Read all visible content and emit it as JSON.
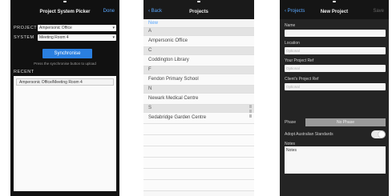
{
  "screen1": {
    "title": "Project System Picker",
    "done_label": "Done",
    "project_label": "PROJECT",
    "project_value": "Ampersonic Office",
    "system_label": "SYSTEM",
    "system_value": "Meeting Room 4",
    "sync_button": "Synchronise",
    "hint": "Press the synchronise button to upload",
    "recent_header": "RECENT",
    "recent_items": [
      "Ampersonic Office/Meeting Room 4"
    ]
  },
  "screen2": {
    "back_label": "Back",
    "title": "Projects",
    "new_label": "New",
    "rows": [
      {
        "kind": "hdr",
        "text": "A"
      },
      {
        "kind": "item",
        "text": "Ampersonic Office"
      },
      {
        "kind": "hdr",
        "text": "C"
      },
      {
        "kind": "item",
        "text": "Coddington Library"
      },
      {
        "kind": "hdr",
        "text": "F"
      },
      {
        "kind": "item",
        "text": "Fendon Primary School"
      },
      {
        "kind": "hdr",
        "text": "N"
      },
      {
        "kind": "item",
        "text": "Newark Medical Centre"
      },
      {
        "kind": "hdr",
        "text": "S"
      },
      {
        "kind": "item",
        "text": "Sedabridge Garden Centre"
      },
      {
        "kind": "blank",
        "text": ""
      },
      {
        "kind": "blank",
        "text": ""
      },
      {
        "kind": "blank",
        "text": ""
      },
      {
        "kind": "blank",
        "text": ""
      },
      {
        "kind": "blank",
        "text": ""
      },
      {
        "kind": "blank",
        "text": ""
      }
    ]
  },
  "screen3": {
    "back_label": "Projects",
    "title": "New Project",
    "save_label": "Save",
    "name_label": "Name",
    "location_label": "Location",
    "location_placeholder": "Optional",
    "your_ref_label": "Your Project Ref",
    "your_ref_placeholder": "Optional",
    "client_ref_label": "Client's Project Ref",
    "client_ref_placeholder": "Optional",
    "phase_label": "Phase",
    "phase_value": "No Phase",
    "aus_label": "Adopt Australian Standards",
    "notes_label": "Notes",
    "notes_text": "Notes"
  },
  "colors": {
    "accent": "#2a7fe0",
    "link": "#5aa8ff"
  }
}
